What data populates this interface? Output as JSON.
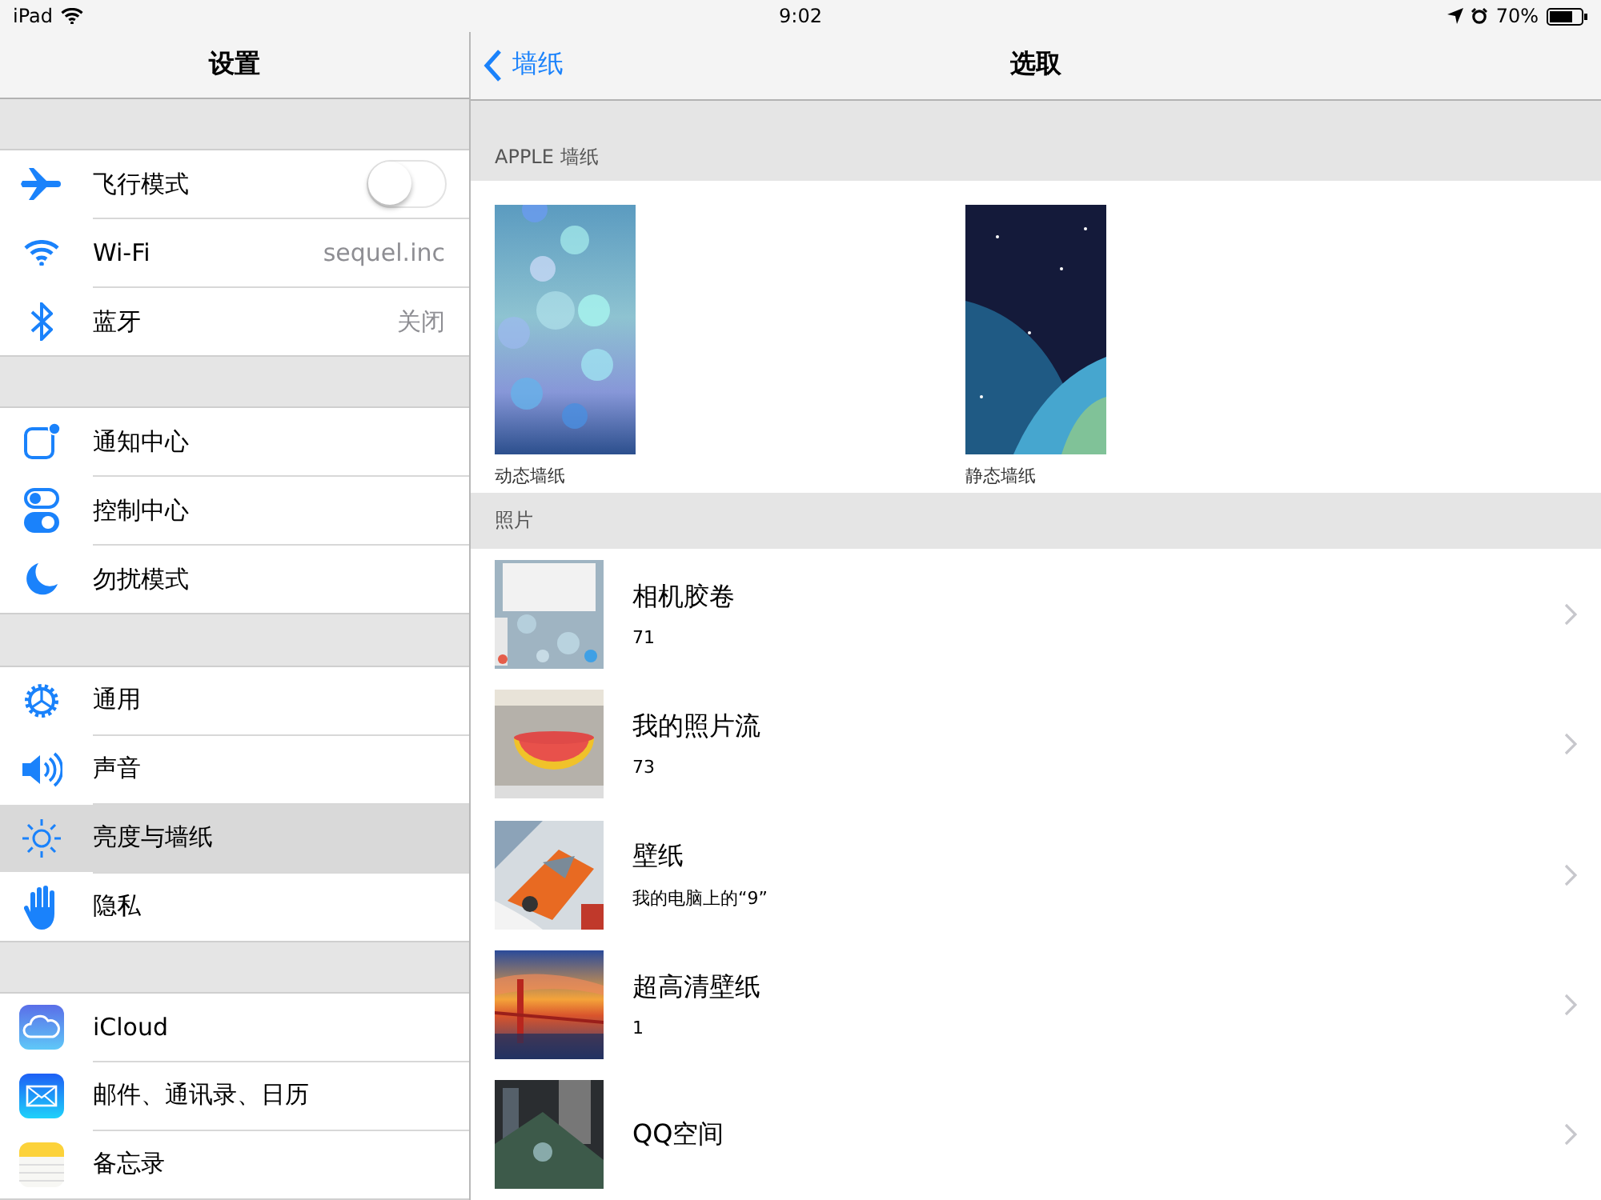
{
  "status_bar": {
    "device": "iPad",
    "time": "9:02",
    "battery": "70%"
  },
  "sidebar": {
    "title": "设置",
    "groups": [
      {
        "items": [
          {
            "label": "飞行模式",
            "kind": "toggle",
            "on": false,
            "selected": false
          },
          {
            "label": "Wi-Fi",
            "kind": "value",
            "value": "sequel.inc",
            "selected": false
          },
          {
            "label": "蓝牙",
            "kind": "value",
            "value": "关闭",
            "selected": false
          }
        ]
      },
      {
        "items": [
          {
            "label": "通知中心",
            "kind": "plain",
            "selected": false
          },
          {
            "label": "控制中心",
            "kind": "plain",
            "selected": false
          },
          {
            "label": "勿扰模式",
            "kind": "plain",
            "selected": false
          }
        ]
      },
      {
        "items": [
          {
            "label": "通用",
            "kind": "plain",
            "selected": false
          },
          {
            "label": "声音",
            "kind": "plain",
            "selected": false
          },
          {
            "label": "亮度与墙纸",
            "kind": "plain",
            "selected": true
          },
          {
            "label": "隐私",
            "kind": "plain",
            "selected": false
          }
        ]
      },
      {
        "items": [
          {
            "label": "iCloud",
            "kind": "plain",
            "selected": false
          },
          {
            "label": "邮件、通讯录、日历",
            "kind": "plain",
            "selected": false
          },
          {
            "label": "备忘录",
            "kind": "plain",
            "selected": false
          }
        ]
      }
    ]
  },
  "nav": {
    "back": "墙纸",
    "title": "选取"
  },
  "apple_section": {
    "header": "APPLE 墙纸",
    "wallpapers": [
      {
        "label": "动态墙纸"
      },
      {
        "label": "静态墙纸"
      }
    ]
  },
  "photos_section": {
    "header": "照片",
    "albums": [
      {
        "name": "相机胶卷",
        "detail": "71"
      },
      {
        "name": "我的照片流",
        "detail": "73"
      },
      {
        "name": "壁纸",
        "detail": "我的电脑上的“9”"
      },
      {
        "name": "超高清壁纸",
        "detail": "1"
      },
      {
        "name": "QQ空间"
      }
    ]
  }
}
